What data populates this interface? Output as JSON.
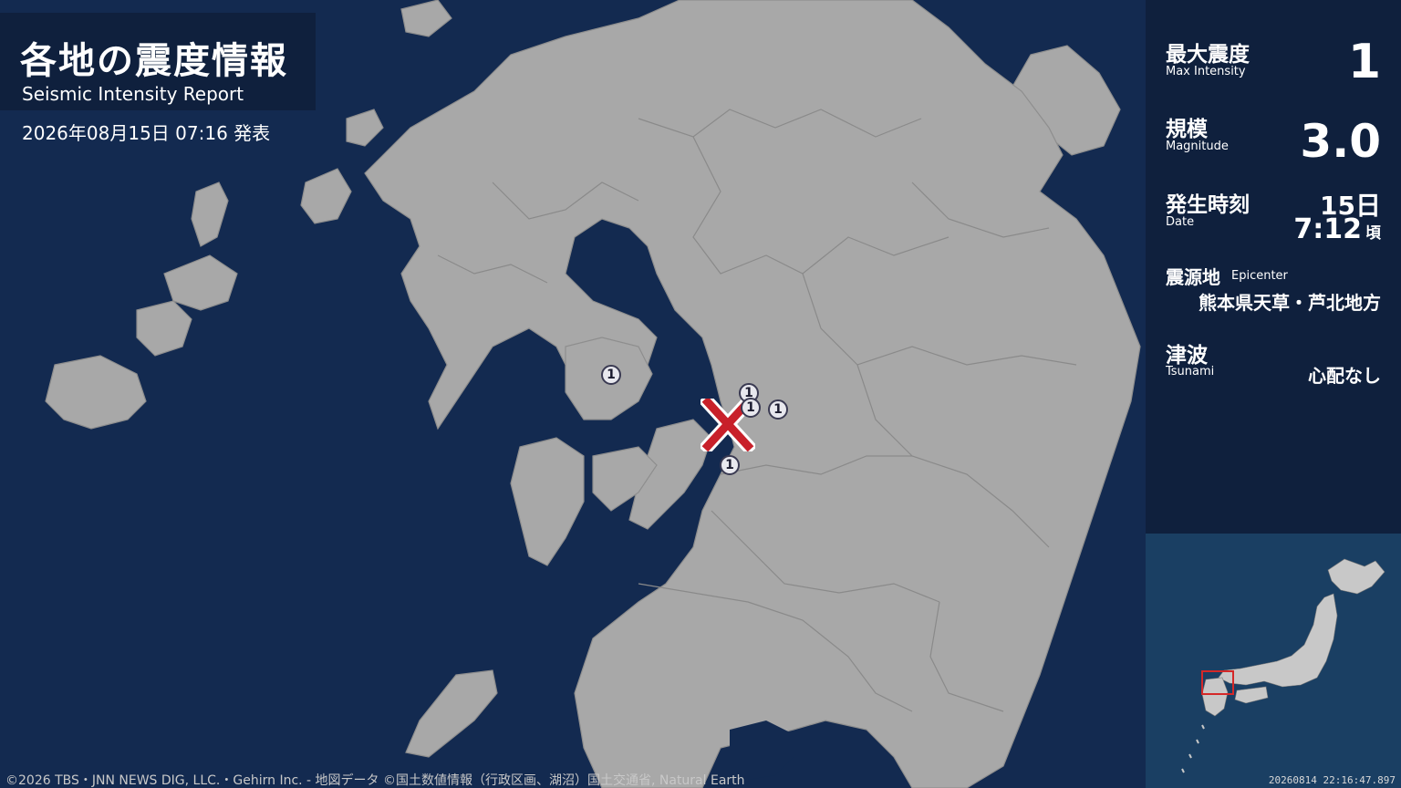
{
  "header": {
    "title_jp": "各地の震度情報",
    "title_en": "Seismic Intensity Report",
    "issued": "2026年08月15日 07:16 発表"
  },
  "info": {
    "max_intensity": {
      "label_jp": "最大震度",
      "label_en": "Max Intensity",
      "value": "1"
    },
    "magnitude": {
      "label_jp": "規模",
      "label_en": "Magnitude",
      "value": "3.0"
    },
    "date": {
      "label_jp": "発生時刻",
      "label_en": "Date",
      "day": "15日",
      "time": "7:12",
      "suffix": "頃"
    },
    "epicenter": {
      "label_jp": "震源地",
      "label_en": "Epicenter",
      "value": "熊本県天草・芦北地方"
    },
    "tsunami": {
      "label_jp": "津波",
      "label_en": "Tsunami",
      "value": "心配なし"
    }
  },
  "map": {
    "epicenter_mark": "x-mark-icon",
    "intensity_badges": [
      "1",
      "1",
      "1",
      "1",
      "1"
    ]
  },
  "inset": {
    "timestamp": "20260814 22:16:47.897"
  },
  "footer": {
    "credits": "©2026 TBS・JNN NEWS DIG, LLC.・Gehirn Inc. - 地図データ ©国土数値情報（行政区画、湖沼）国土交通省, Natural Earth"
  },
  "colors": {
    "sea": "#132a50",
    "land": "#a8a8a8",
    "panel": "#0f203d",
    "epicenter": "#c8202a"
  }
}
